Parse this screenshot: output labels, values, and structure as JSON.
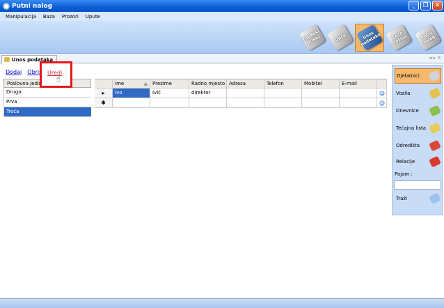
{
  "window": {
    "title": "Putni nalog"
  },
  "menu": [
    "Manipulacija",
    "Baza",
    "Prozori",
    "Upute"
  ],
  "ribbon": [
    {
      "label": "Grafički prikaz",
      "icon": "chart-tile-icon",
      "active": false
    },
    {
      "label": "Opće",
      "icon": "general-tile-icon",
      "active": false
    },
    {
      "label": "Unos podataka",
      "icon": "data-entry-tile-icon",
      "active": true
    },
    {
      "label": "Loco vožnja",
      "icon": "loco-tile-icon",
      "active": false
    },
    {
      "label": "Putni nalog",
      "icon": "travel-order-tile-icon",
      "active": false
    }
  ],
  "tab": {
    "label": "Unos podataka",
    "nav": "◂ ▸ ✕"
  },
  "links": {
    "add": "Dodaj",
    "delete": "Obriši",
    "edit": "Uredi"
  },
  "left_table": {
    "header": "Poslovna jedinica",
    "rows": [
      "Druga",
      "Prva",
      "Treća"
    ]
  },
  "grid": {
    "columns": [
      "Ime",
      "Prezime",
      "Radno mjesto",
      "Adresa",
      "Telefon",
      "Mobitel",
      "E-mail"
    ],
    "rows": [
      [
        "Ivo",
        "Ivić",
        "direktor",
        "",
        "",
        "",
        ""
      ]
    ]
  },
  "side": {
    "items": [
      "Djelatnici",
      "Vozila",
      "Dnevnice",
      "Tečajna lista",
      "Odredišta",
      "Relacije"
    ],
    "pojam_label": "Pojam :",
    "search": "Traži"
  },
  "colors": {
    "accent": "#f6b86b",
    "selection": "#316ac5",
    "titlebar": "#0a5fd8"
  }
}
